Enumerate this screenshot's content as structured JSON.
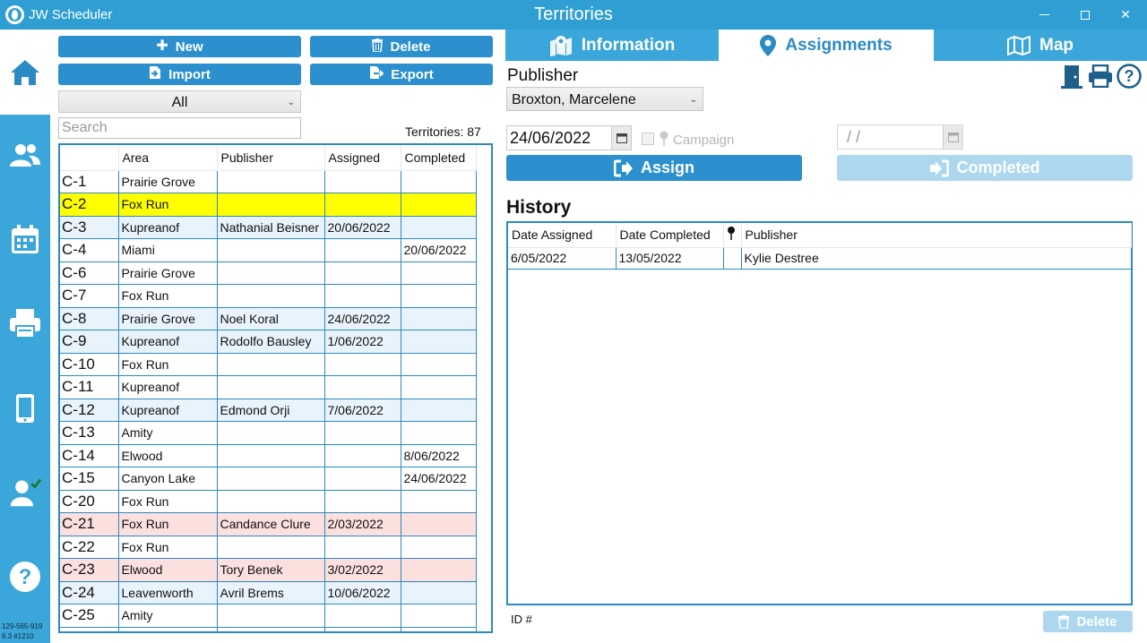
{
  "app": {
    "name": "JW Scheduler",
    "window_title": "Territories"
  },
  "window_controls": {
    "minimize": "",
    "maximize": "",
    "close": "✕"
  },
  "sidebar": {
    "items": [
      {
        "name": "home",
        "icon": "home-icon"
      },
      {
        "name": "publishers",
        "icon": "people-icon"
      },
      {
        "name": "schedule",
        "icon": "calendar-icon"
      },
      {
        "name": "print",
        "icon": "printer-icon"
      },
      {
        "name": "mobile",
        "icon": "phone-icon"
      },
      {
        "name": "territory-assign",
        "icon": "user-check-icon"
      },
      {
        "name": "help",
        "icon": "help-icon"
      }
    ],
    "build_line1": "129-565-919",
    "build_line2": "6.3 #1210"
  },
  "toolbar": {
    "new_label": "New",
    "delete_label": "Delete",
    "import_label": "Import",
    "export_label": "Export"
  },
  "filter": {
    "selected": "All"
  },
  "search": {
    "placeholder": "Search",
    "value": ""
  },
  "territory_count": {
    "label": "Territories:",
    "value": "87"
  },
  "territory_table": {
    "columns": [
      "",
      "Area",
      "Publisher",
      "Assigned",
      "Completed"
    ],
    "rows": [
      {
        "id": "C-1",
        "area": "Prairie Grove",
        "publisher": "",
        "assigned": "",
        "completed": "",
        "style": ""
      },
      {
        "id": "C-2",
        "area": "Fox Run",
        "publisher": "",
        "assigned": "",
        "completed": "",
        "style": "yellow"
      },
      {
        "id": "C-3",
        "area": "Kupreanof",
        "publisher": "Nathanial Beisner",
        "assigned": "20/06/2022",
        "completed": "",
        "style": "blue"
      },
      {
        "id": "C-4",
        "area": "Miami",
        "publisher": "",
        "assigned": "",
        "completed": "20/06/2022",
        "style": ""
      },
      {
        "id": "C-6",
        "area": "Prairie Grove",
        "publisher": "",
        "assigned": "",
        "completed": "",
        "style": ""
      },
      {
        "id": "C-7",
        "area": "Fox Run",
        "publisher": "",
        "assigned": "",
        "completed": "",
        "style": ""
      },
      {
        "id": "C-8",
        "area": "Prairie Grove",
        "publisher": "Noel Koral",
        "assigned": "24/06/2022",
        "completed": "",
        "style": "blue"
      },
      {
        "id": "C-9",
        "area": "Kupreanof",
        "publisher": "Rodolfo Bausley",
        "assigned": "1/06/2022",
        "completed": "",
        "style": "blue"
      },
      {
        "id": "C-10",
        "area": "Fox Run",
        "publisher": "",
        "assigned": "",
        "completed": "",
        "style": ""
      },
      {
        "id": "C-11",
        "area": "Kupreanof",
        "publisher": "",
        "assigned": "",
        "completed": "",
        "style": ""
      },
      {
        "id": "C-12",
        "area": "Kupreanof",
        "publisher": "Edmond Orji",
        "assigned": "7/06/2022",
        "completed": "",
        "style": "blue"
      },
      {
        "id": "C-13",
        "area": "Amity",
        "publisher": "",
        "assigned": "",
        "completed": "",
        "style": ""
      },
      {
        "id": "C-14",
        "area": "Elwood",
        "publisher": "",
        "assigned": "",
        "completed": "8/06/2022",
        "style": ""
      },
      {
        "id": "C-15",
        "area": "Canyon Lake",
        "publisher": "",
        "assigned": "",
        "completed": "24/06/2022",
        "style": ""
      },
      {
        "id": "C-20",
        "area": "Fox Run",
        "publisher": "",
        "assigned": "",
        "completed": "",
        "style": ""
      },
      {
        "id": "C-21",
        "area": "Fox Run",
        "publisher": "Candance Clure",
        "assigned": "2/03/2022",
        "completed": "",
        "style": "pink"
      },
      {
        "id": "C-22",
        "area": "Fox Run",
        "publisher": "",
        "assigned": "",
        "completed": "",
        "style": ""
      },
      {
        "id": "C-23",
        "area": "Elwood",
        "publisher": "Tory Benek",
        "assigned": "3/02/2022",
        "completed": "",
        "style": "pink"
      },
      {
        "id": "C-24",
        "area": "Leavenworth",
        "publisher": "Avril Brems",
        "assigned": "10/06/2022",
        "completed": "",
        "style": "blue"
      },
      {
        "id": "C-25",
        "area": "Amity",
        "publisher": "",
        "assigned": "",
        "completed": "",
        "style": ""
      },
      {
        "id": "C-26",
        "area": "",
        "publisher": "",
        "assigned": "",
        "completed": "",
        "style": ""
      }
    ]
  },
  "tabs": [
    {
      "label": "Information",
      "icon": "map-pin-icon"
    },
    {
      "label": "Assignments",
      "icon": "location-pin-icon"
    },
    {
      "label": "Map",
      "icon": "map-icon"
    }
  ],
  "assignment": {
    "publisher_label": "Publisher",
    "publisher_selected": "Broxton, Marcelene",
    "date_assigned": "24/06/2022",
    "campaign_label": "Campaign",
    "date_completed": " /  /",
    "assign_label": "Assign",
    "completed_label": "Completed"
  },
  "history": {
    "title": "History",
    "columns": [
      "Date Assigned",
      "Date Completed",
      "",
      "Publisher"
    ],
    "rows": [
      {
        "assigned": "6/05/2022",
        "completed": "13/05/2022",
        "campaign": "",
        "publisher": "Kylie Destree"
      }
    ],
    "id_label": "ID #",
    "delete_label": "Delete"
  },
  "colors": {
    "accent": "#2f9fd3",
    "button": "#2b90cd",
    "button_disabled": "#acd7ef",
    "row_yellow": "#ffff00",
    "row_blue": "#e8f3fb",
    "row_pink": "#fbe0de"
  }
}
